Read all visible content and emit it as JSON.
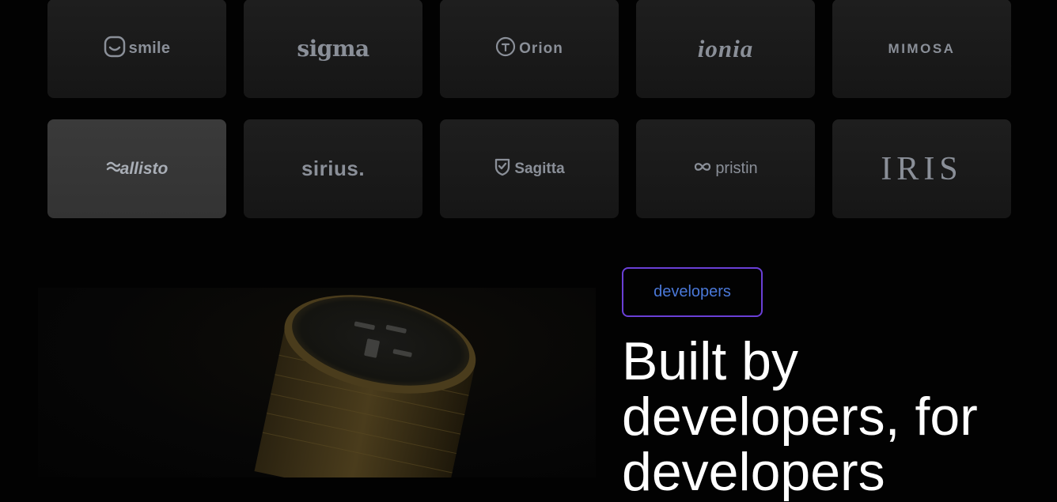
{
  "logos": [
    {
      "name": "smile",
      "icon": "smile-face-icon"
    },
    {
      "name": "sigma",
      "icon": null
    },
    {
      "name": "Orion",
      "icon": "orion-circle-icon"
    },
    {
      "name": "ionia",
      "icon": null
    },
    {
      "name": "MIMOSA",
      "icon": null
    },
    {
      "name": "allisto",
      "icon": "callisto-wave-icon"
    },
    {
      "name": "sirius.",
      "icon": null
    },
    {
      "name": "Sagitta",
      "icon": "shield-check-icon"
    },
    {
      "name": "pristin",
      "icon": "infinity-icon"
    },
    {
      "name": "IRIS",
      "icon": null
    }
  ],
  "section": {
    "tag_label": "developers",
    "headline": "Built by developers, for developers"
  },
  "colors": {
    "background": "#020202",
    "card": "#1a1a1a",
    "card_active": "#363636",
    "logo_text": "#8a8f98",
    "pill_border": "#6a3fd6",
    "pill_text": "#4a78d8",
    "headline": "#ffffff"
  }
}
